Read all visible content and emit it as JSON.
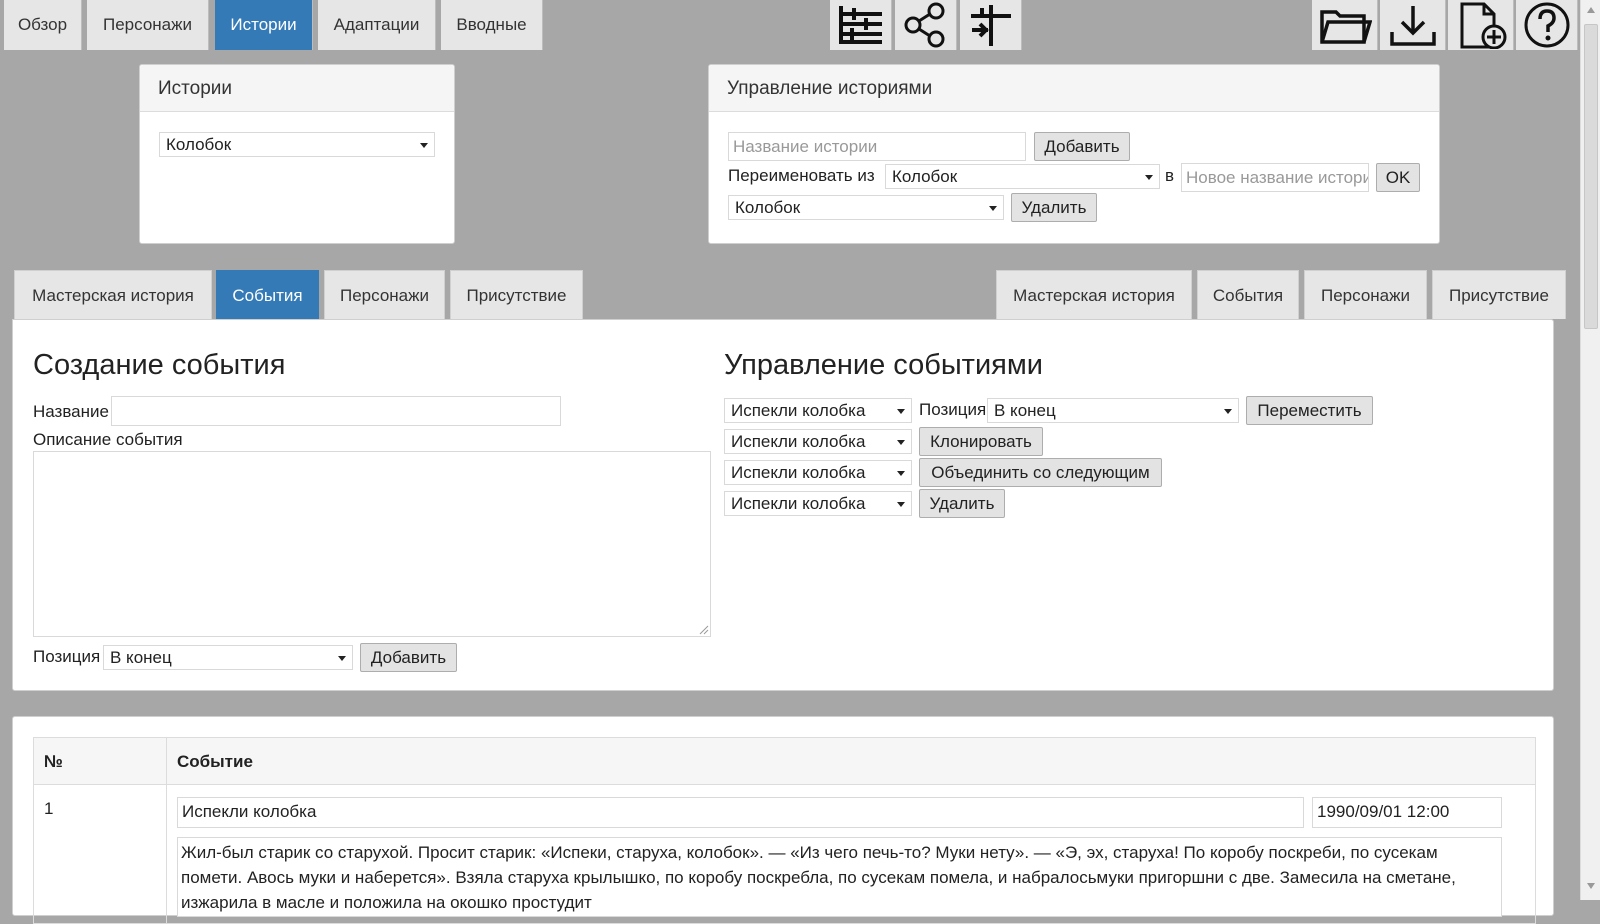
{
  "top_tabs": [
    {
      "label": "Обзор",
      "active": false
    },
    {
      "label": "Персонажи",
      "active": false
    },
    {
      "label": "Истории",
      "active": true
    },
    {
      "label": "Адаптации",
      "active": false
    },
    {
      "label": "Вводные",
      "active": false
    }
  ],
  "toolbar_icons": [
    "timeline-icon",
    "share-graph-icon",
    "split-icon"
  ],
  "file_icons": [
    "folder-open-icon",
    "download-icon",
    "new-file-icon",
    "help-icon"
  ],
  "stories_panel": {
    "title": "Истории",
    "selected_story": "Колобок"
  },
  "manage_panel": {
    "title": "Управление историями",
    "name_placeholder": "Название истории",
    "add_label": "Добавить",
    "rename_label": "Переименовать из",
    "rename_from": "Колобок",
    "to_label": "в",
    "new_name_placeholder": "Новое название истори",
    "ok_label": "OK",
    "delete_select": "Колобок",
    "delete_label": "Удалить"
  },
  "sub_tabs_left": [
    {
      "label": "Мастерская история",
      "active": false
    },
    {
      "label": "События",
      "active": true
    },
    {
      "label": "Персонажи",
      "active": false
    },
    {
      "label": "Присутствие",
      "active": false
    }
  ],
  "sub_tabs_right": [
    {
      "label": "Мастерская история",
      "active": false
    },
    {
      "label": "События",
      "active": false
    },
    {
      "label": "Персонажи",
      "active": false
    },
    {
      "label": "Присутствие",
      "active": false
    }
  ],
  "create_event": {
    "title": "Создание события",
    "name_label": "Название",
    "name_value": "",
    "description_label": "Описание события",
    "description_value": "",
    "position_label": "Позиция",
    "position_value": "В конец",
    "add_label": "Добавить"
  },
  "manage_events": {
    "title": "Управление событиями",
    "move_event": "Испекли колобка",
    "position_label": "Позиция",
    "position_value": "В конец",
    "move_label": "Переместить",
    "clone_event": "Испекли колобка",
    "clone_label": "Клонировать",
    "merge_event": "Испекли колобка",
    "merge_label": "Объединить со следующим",
    "delete_event": "Испекли колобка",
    "delete_label": "Удалить"
  },
  "events_table": {
    "headers": [
      "№",
      "Событие"
    ],
    "rows": [
      {
        "num": "1",
        "name": "Испекли колобка",
        "time": "1990/09/01 12:00",
        "description": "Жил-был старик со старухой. Просит старик: «Испеки, старуха, колобок». — «Из чего печь-то? Муки нету». — «Э, эх, старуха! По коробу поскреби, по сусекам помети. Авось муки и наберется». Взяла старуха крылышко, по коробу поскребла, по сусекам помела, и набралосьмуки пригоршни с две. Замесила на сметане, изжарила в масле и положила на окошко простудит"
      }
    ]
  }
}
